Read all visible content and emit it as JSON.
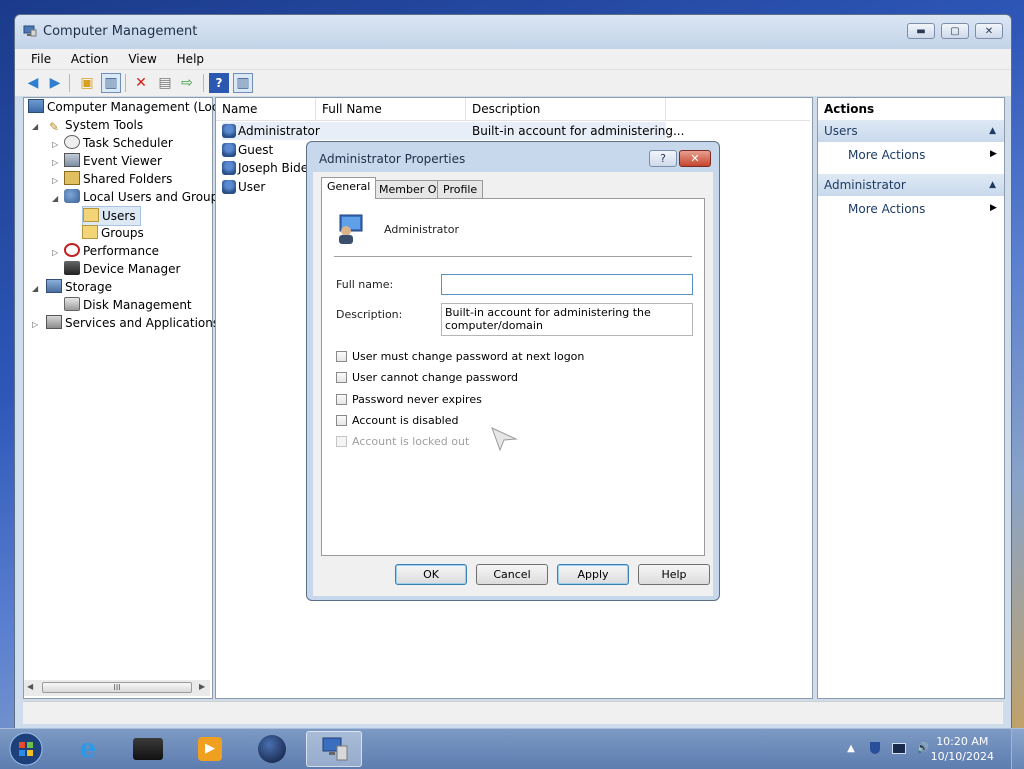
{
  "window": {
    "title": "Computer Management",
    "min_label": "▬",
    "max_label": "▢",
    "close_label": "✕"
  },
  "menu": [
    "File",
    "Action",
    "View",
    "Help"
  ],
  "tree": {
    "items": [
      "Computer Management (Local",
      "System Tools",
      "Task Scheduler",
      "Event Viewer",
      "Shared Folders",
      "Local Users and Groups",
      "Users",
      "Groups",
      "Performance",
      "Device Manager",
      "Storage",
      "Disk Management",
      "Services and Applications"
    ],
    "scroll_grip": "III"
  },
  "list": {
    "columns": [
      "Name",
      "Full Name",
      "Description"
    ],
    "rows": [
      {
        "name": "Administrator",
        "full_name": "",
        "description": "Built-in account for administering..."
      },
      {
        "name": "Guest",
        "full_name": "",
        "description": ""
      },
      {
        "name": "Joseph Biden",
        "full_name": "",
        "description": ""
      },
      {
        "name": "User",
        "full_name": "",
        "description": ""
      }
    ]
  },
  "actions": {
    "header": "Actions",
    "sections": [
      {
        "title": "Users",
        "item": "More Actions"
      },
      {
        "title": "Administrator",
        "item": "More Actions"
      }
    ]
  },
  "dialog": {
    "title": "Administrator Properties",
    "help_label": "?",
    "close_label": "✕",
    "tabs": [
      "General",
      "Member Of",
      "Profile"
    ],
    "account_name": "Administrator",
    "full_name_label": "Full name:",
    "full_name_value": "",
    "description_label": "Description:",
    "description_value": "Built-in account for administering the computer/domain",
    "checkboxes": [
      "User must change password at next logon",
      "User cannot change password",
      "Password never expires",
      "Account is disabled",
      "Account is locked out"
    ],
    "buttons": [
      "OK",
      "Cancel",
      "Apply",
      "Help"
    ]
  },
  "taskbar": {
    "time": "10:20 AM",
    "date": "10/10/2024",
    "tray_expand": "▲"
  },
  "colors": {
    "accent": "#3c7fb1",
    "close": "#c4452e"
  }
}
